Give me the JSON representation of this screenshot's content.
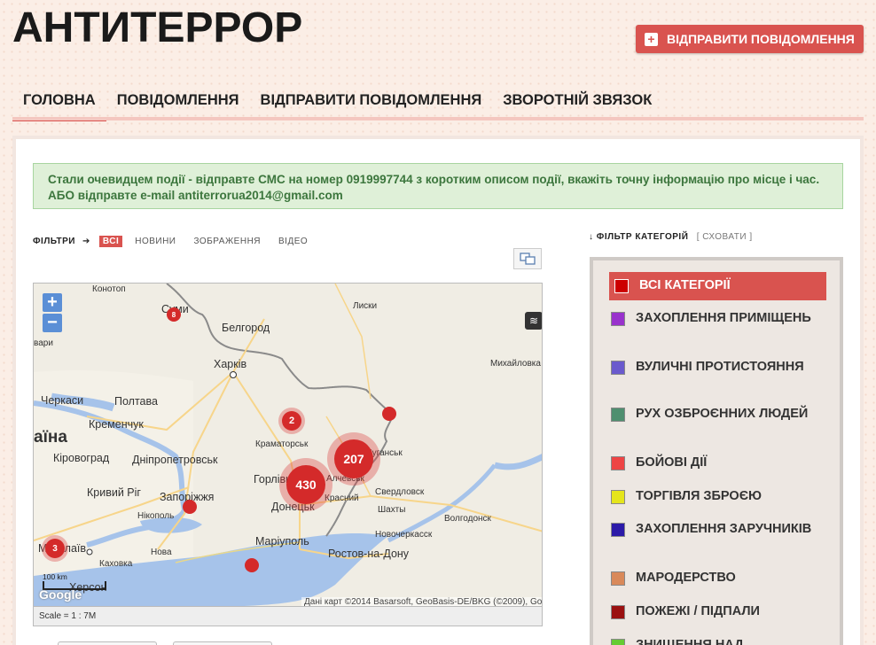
{
  "header": {
    "title": "АНТИТЕРРОР",
    "send_button": "ВІДПРАВИТИ ПОВІДОМЛЕННЯ"
  },
  "nav": {
    "items": [
      {
        "label": "ГОЛОВНА",
        "active": true
      },
      {
        "label": "ПОВІДОМЛЕННЯ"
      },
      {
        "label": "ВІДПРАВИТИ ПОВІДОМЛЕННЯ"
      },
      {
        "label": "ЗВОРОТНІЙ ЗВЯЗОК"
      }
    ]
  },
  "alert": {
    "text": "Стали очевидцем події - відправте СМС на номер 0919997744 з коротким описом події, вкажіть точну інформацію про місце і час. АБО відправте e-mail antiterrorua2014@gmail.com"
  },
  "filters": {
    "label": "ФІЛЬТРИ",
    "tabs": [
      "ВСІ",
      "НОВИНИ",
      "ЗОБРАЖЕННЯ",
      "ВІДЕО"
    ],
    "active_tab": "ВСІ"
  },
  "map": {
    "cities": [
      {
        "name": "Конотоп"
      },
      {
        "name": "Суми"
      },
      {
        "name": "Белгород"
      },
      {
        "name": "Лиски"
      },
      {
        "name": "Харків"
      },
      {
        "name": "Черкаси"
      },
      {
        "name": "Полтава"
      },
      {
        "name": "Кременчук"
      },
      {
        "name": "Михайловка"
      },
      {
        "name": "аїна"
      },
      {
        "name": "Кіровоград"
      },
      {
        "name": "Дніпропетровськ"
      },
      {
        "name": "Краматорськ"
      },
      {
        "name": "Луганськ"
      },
      {
        "name": "Горлівка"
      },
      {
        "name": "Алчевськ"
      },
      {
        "name": "Донецьк"
      },
      {
        "name": "Свердловск"
      },
      {
        "name": "Красний"
      },
      {
        "name": "Кривий Ріг"
      },
      {
        "name": "Запоріжжя"
      },
      {
        "name": "Нікополь"
      },
      {
        "name": "Шахты"
      },
      {
        "name": "Волгодонск"
      },
      {
        "name": "Новочеркасск"
      },
      {
        "name": "Маріуполь"
      },
      {
        "name": "Миколаїв"
      },
      {
        "name": "Ростов-на-Дону"
      },
      {
        "name": "Херсон"
      },
      {
        "name": "Каховка"
      },
      {
        "name": "Нова"
      },
      {
        "name": "вари"
      }
    ],
    "clusters": [
      {
        "count": "430"
      },
      {
        "count": "207"
      },
      {
        "count": "2"
      },
      {
        "count": "3"
      },
      {
        "count": "8"
      },
      {
        "count": ""
      },
      {
        "count": ""
      },
      {
        "count": ""
      }
    ],
    "zoom_in": "+",
    "zoom_out": "−",
    "attribution": "Дані карт ©2014 Basarsoft, GeoBasis-DE/BKG (©2009), Google",
    "google": "Google",
    "scale_text": "100 km",
    "scale_label": "Scale = 1 : 7M"
  },
  "categories": {
    "header": "ФІЛЬТР КАТЕГОРІЙ",
    "hide": "[ СХОВАТИ ]",
    "items": [
      {
        "label": "ВСІ КАТЕГОРІЇ",
        "color": "#cc0000",
        "active": true
      },
      {
        "label": "ЗАХОПЛЕННЯ ПРИМІЩЕНЬ",
        "color": "#9932cc"
      },
      {
        "label": "ВУЛИЧНІ ПРОТИСТОЯННЯ",
        "color": "#6a5acd"
      },
      {
        "label": "РУХ ОЗБРОЄННИХ ЛЮДЕЙ",
        "color": "#4f8f6f"
      },
      {
        "label": "БОЙОВІ ДІЇ",
        "color": "#ee4444"
      },
      {
        "label": "ТОРГІВЛЯ ЗБРОЄЮ",
        "color": "#e5e51b"
      },
      {
        "label": "ЗАХОПЛЕННЯ ЗАРУЧНИКІВ",
        "color": "#2b1aa8"
      },
      {
        "label": "МАРОДЕРСТВО",
        "color": "#d9895a"
      },
      {
        "label": "ПОЖЕЖІ / ПІДПАЛИ",
        "color": "#9a1010"
      },
      {
        "label": "ЗНИЩЕННЯ НАД",
        "color": "#66cc33"
      }
    ]
  }
}
